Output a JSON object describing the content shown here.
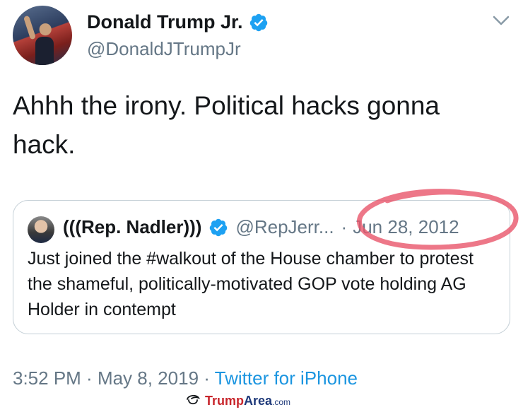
{
  "author": {
    "display_name": "Donald Trump Jr.",
    "handle": "@DonaldJTrumpJr"
  },
  "tweet": {
    "text": "Ahhh the irony. Political hacks gonna hack."
  },
  "quoted_tweet": {
    "display_name": "(((Rep. Nadler)))",
    "handle": "@RepJerr...",
    "separator": "·",
    "date": "Jun 28, 2012",
    "text": "Just joined the #walkout of the House chamber to protest the shameful, politically-motivated GOP vote holding AG Holder in contempt"
  },
  "footer": {
    "time": "3:52 PM",
    "sep1": " · ",
    "date": "May 8, 2019",
    "sep2": " · ",
    "source": "Twitter for iPhone"
  },
  "watermark": {
    "brand_a": "Trump",
    "brand_b": "Area",
    "tld": ".com"
  },
  "colors": {
    "verified": "#1da1f2",
    "secondary_text": "#657786",
    "link": "#1b95e0",
    "annotation": "#e8556a"
  },
  "icons": {
    "verified": "verified-badge-icon",
    "menu": "chevron-down-icon"
  }
}
